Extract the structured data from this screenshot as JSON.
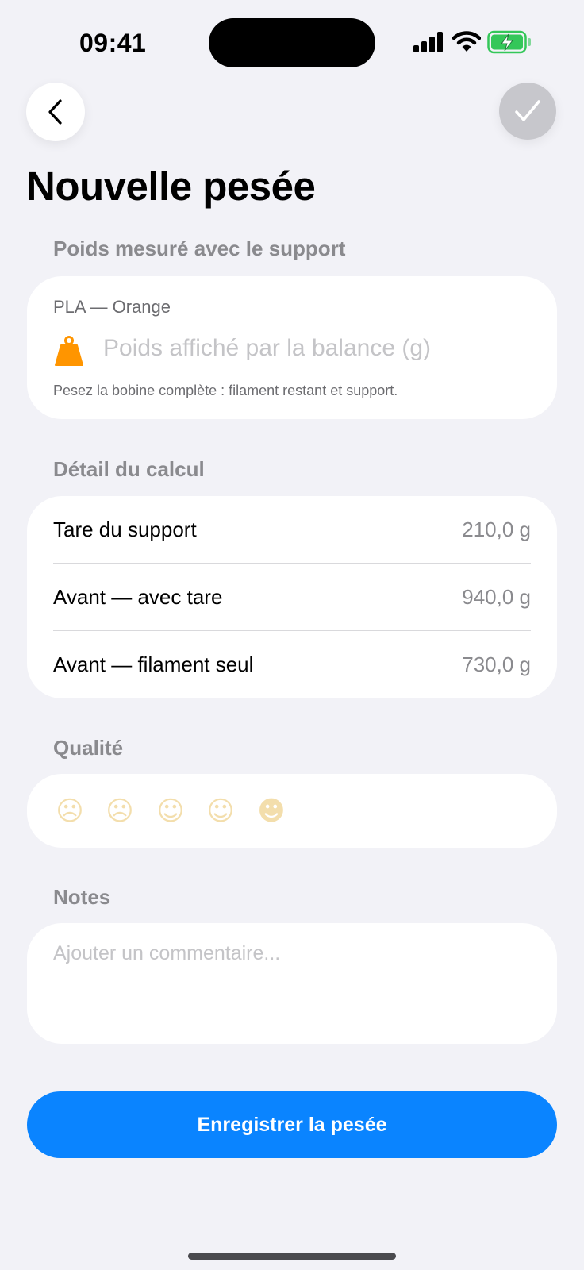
{
  "status_bar": {
    "time": "09:41"
  },
  "nav": {
    "back_icon": "chevron-left-icon",
    "confirm_icon": "checkmark-icon"
  },
  "page": {
    "title": "Nouvelle pesée"
  },
  "weight_section": {
    "header": "Poids mesuré avec le support",
    "spool_label": "PLA — Orange",
    "input_value": "",
    "input_placeholder": "Poids affiché par la balance (g)",
    "hint": "Pesez la bobine complète : filament restant et support.",
    "icon": "weight-icon",
    "icon_color": "#ff9500"
  },
  "calc_section": {
    "header": "Détail du calcul",
    "rows": [
      {
        "label": "Tare du support",
        "value": "210,0 g"
      },
      {
        "label": "Avant — avec tare",
        "value": "940,0 g"
      },
      {
        "label": "Avant — filament seul",
        "value": "730,0 g"
      }
    ]
  },
  "quality_section": {
    "header": "Qualité",
    "options": [
      {
        "name": "disappointed-face-icon",
        "glyph": "☹"
      },
      {
        "name": "confused-face-icon",
        "glyph": "☹"
      },
      {
        "name": "neutral-face-icon",
        "glyph": "☺"
      },
      {
        "name": "smiling-face-icon",
        "glyph": "☺"
      },
      {
        "name": "heart-eyes-face-icon",
        "glyph": "☻"
      }
    ]
  },
  "notes_section": {
    "header": "Notes",
    "value": "",
    "placeholder": "Ajouter un commentaire..."
  },
  "save_button": {
    "label": "Enregistrer la pesée",
    "color": "#0a84ff"
  }
}
